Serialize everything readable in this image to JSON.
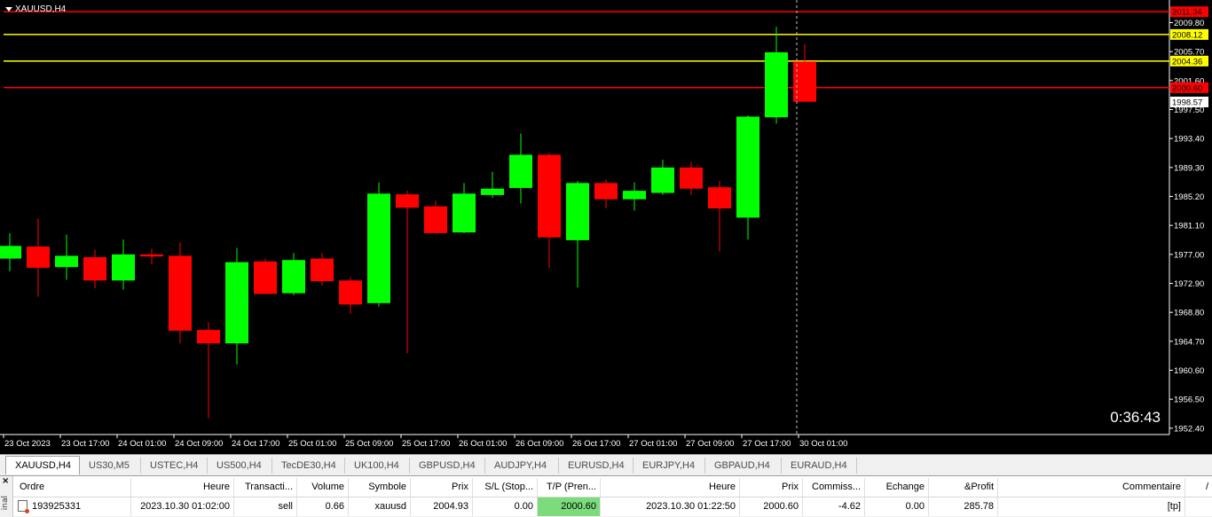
{
  "chart": {
    "title": "XAUUSD,H4",
    "countdown": "0:36:43"
  },
  "colors": {
    "background": "#000000",
    "bull": "#00ff00",
    "bear": "#ff0000",
    "red_line": "#ff0000",
    "yellow_line": "#ffff00",
    "axis_text": "#ffffff",
    "crosshair": "#c0c0c0"
  },
  "chart_data": {
    "type": "candlestick",
    "symbol": "XAUUSD",
    "timeframe": "H4",
    "y_ticks": [
      "2009.80",
      "2005.70",
      "2001.60",
      "1997.50",
      "1993.40",
      "1989.30",
      "1985.20",
      "1981.10",
      "1977.00",
      "1972.90",
      "1968.80",
      "1964.70",
      "1960.60",
      "1956.50",
      "1952.40"
    ],
    "x_ticks": [
      "23 Oct 2023",
      "23 Oct 17:00",
      "24 Oct 01:00",
      "24 Oct 09:00",
      "24 Oct 17:00",
      "25 Oct 01:00",
      "25 Oct 09:00",
      "25 Oct 17:00",
      "26 Oct 01:00",
      "26 Oct 09:00",
      "26 Oct 17:00",
      "27 Oct 01:00",
      "27 Oct 09:00",
      "27 Oct 17:00",
      "30 Oct 01:00"
    ],
    "ylim": [
      1951.5,
      2012.5
    ],
    "candles": [
      {
        "o": 1976.4,
        "h": 1980.0,
        "l": 1974.6,
        "c": 1978.2
      },
      {
        "o": 1978.1,
        "h": 1982.1,
        "l": 1971.0,
        "c": 1975.1
      },
      {
        "o": 1975.2,
        "h": 1979.8,
        "l": 1973.4,
        "c": 1976.8
      },
      {
        "o": 1976.6,
        "h": 1977.7,
        "l": 1972.2,
        "c": 1973.3
      },
      {
        "o": 1973.3,
        "h": 1979.1,
        "l": 1972.0,
        "c": 1977.0
      },
      {
        "o": 1977.0,
        "h": 1977.8,
        "l": 1975.6,
        "c": 1976.7
      },
      {
        "o": 1976.8,
        "h": 1978.7,
        "l": 1964.4,
        "c": 1966.2
      },
      {
        "o": 1966.3,
        "h": 1967.4,
        "l": 1953.8,
        "c": 1964.4
      },
      {
        "o": 1964.4,
        "h": 1977.9,
        "l": 1961.4,
        "c": 1975.9
      },
      {
        "o": 1976.0,
        "h": 1976.4,
        "l": 1971.4,
        "c": 1971.4
      },
      {
        "o": 1971.5,
        "h": 1977.2,
        "l": 1971.2,
        "c": 1976.2
      },
      {
        "o": 1976.4,
        "h": 1977.2,
        "l": 1972.6,
        "c": 1973.2
      },
      {
        "o": 1973.3,
        "h": 1973.8,
        "l": 1968.6,
        "c": 1969.9
      },
      {
        "o": 1970.1,
        "h": 1987.2,
        "l": 1969.6,
        "c": 1985.6
      },
      {
        "o": 1985.5,
        "h": 1986.0,
        "l": 1963.0,
        "c": 1983.6
      },
      {
        "o": 1983.8,
        "h": 1984.6,
        "l": 1980.3,
        "c": 1980.0
      },
      {
        "o": 1980.1,
        "h": 1987.1,
        "l": 1980.0,
        "c": 1985.6
      },
      {
        "o": 1985.4,
        "h": 1988.7,
        "l": 1985.0,
        "c": 1986.3
      },
      {
        "o": 1986.4,
        "h": 1994.1,
        "l": 1984.2,
        "c": 1991.1
      },
      {
        "o": 1991.1,
        "h": 1991.4,
        "l": 1975.1,
        "c": 1979.4
      },
      {
        "o": 1979.0,
        "h": 1987.4,
        "l": 1972.3,
        "c": 1987.1
      },
      {
        "o": 1987.1,
        "h": 1987.6,
        "l": 1983.5,
        "c": 1984.8
      },
      {
        "o": 1984.8,
        "h": 1987.2,
        "l": 1983.2,
        "c": 1986.0
      },
      {
        "o": 1985.7,
        "h": 1990.4,
        "l": 1985.4,
        "c": 1989.3
      },
      {
        "o": 1989.3,
        "h": 1990.1,
        "l": 1985.4,
        "c": 1986.3
      },
      {
        "o": 1986.5,
        "h": 1987.4,
        "l": 1977.4,
        "c": 1983.5
      },
      {
        "o": 1982.2,
        "h": 1996.7,
        "l": 1979.1,
        "c": 1996.5
      },
      {
        "o": 1996.4,
        "h": 2009.2,
        "l": 1995.5,
        "c": 2005.6
      },
      {
        "o": 2004.3,
        "h": 2006.8,
        "l": 1998.6,
        "c": 1998.6
      }
    ],
    "horizontal_lines": [
      {
        "price": 2011.34,
        "label": "2011.34",
        "color": "#ff0000",
        "label_bg": "#ff0000",
        "label_fg": "#000000"
      },
      {
        "price": 2008.12,
        "label": "2008.12",
        "color": "#ffff00",
        "label_bg": "#ffff00",
        "label_fg": "#000000"
      },
      {
        "price": 2004.36,
        "label": "2004.36",
        "color": "#ffff00",
        "label_bg": "#ffff00",
        "label_fg": "#000000"
      },
      {
        "price": 2000.6,
        "label": "2000.60",
        "color": "#ff0000",
        "label_bg": "#ff0000",
        "label_fg": "#000000"
      }
    ],
    "current_price": {
      "price": 1998.57,
      "label": "1998.57"
    }
  },
  "symbol_tabs": [
    "XAUUSD,H4",
    "US30,M5",
    "USTEC,H4",
    "US500,H4",
    "TecDE30,H4",
    "UK100,H4",
    "GBPUSD,H4",
    "AUDJPY,H4",
    "EURUSD,H4",
    "EURJPY,H4",
    "GBPAUD,H4",
    "EURAUD,H4"
  ],
  "terminal": {
    "close_glyph": "×",
    "side_label": "inal",
    "sort_arrow": "/",
    "headers": {
      "order": "Ordre",
      "time": "Heure",
      "type": "Transacti...",
      "volume": "Volume",
      "symbol": "Symbole",
      "price": "Prix",
      "sl": "S/L (Stop...",
      "tp": "T/P (Pren...",
      "close_time": "Heure",
      "close_price": "Prix",
      "commission": "Commiss...",
      "swap": "Echange",
      "profit": "&Profit",
      "comment": "Commentaire"
    },
    "row": {
      "order": "193925331",
      "time": "2023.10.30 01:02:00",
      "type": "sell",
      "volume": "0.66",
      "symbol": "xauusd",
      "price": "2004.93",
      "sl": "0.00",
      "tp": "2000.60",
      "close_time": "2023.10.30 01:22:50",
      "close_price": "2000.60",
      "commission": "-4.62",
      "swap": "0.00",
      "profit": "285.78",
      "comment": "[tp]"
    }
  }
}
